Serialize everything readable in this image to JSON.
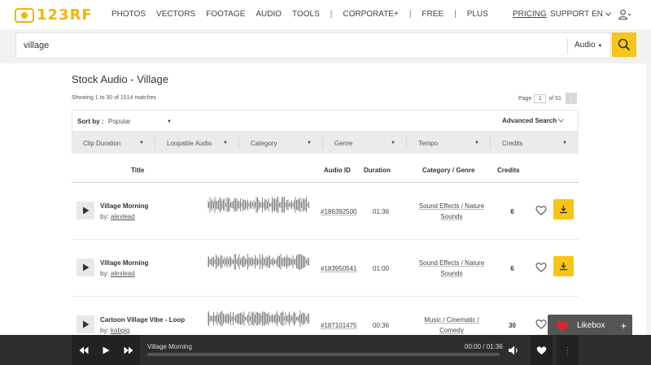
{
  "brand": {
    "logo_text": "123RF"
  },
  "nav": {
    "items": [
      "PHOTOS",
      "VECTORS",
      "FOOTAGE",
      "AUDIO",
      "TOOLS",
      "|",
      "CORPORATE+",
      "|",
      "FREE",
      "|",
      "PLUS"
    ],
    "pricing": "PRICING",
    "support": "SUPPORT",
    "lang": "EN"
  },
  "search": {
    "query": "village",
    "type": "Audio"
  },
  "page": {
    "title": "Stock Audio - Village",
    "showing": "Showing 1 to 30 of 1514 matches",
    "page_label": "Page",
    "page_num": "1",
    "page_total": "of 51"
  },
  "sort": {
    "label": "Sort by :",
    "value": "Popular",
    "advanced": "Advanced Search"
  },
  "filters": [
    "Clip Duration",
    "Loopable Audio",
    "Category",
    "Genre",
    "Tempo",
    "Credits"
  ],
  "table": {
    "headers": {
      "title": "Title",
      "audio_id": "Audio ID",
      "duration": "Duration",
      "category": "Category / Genre",
      "credits": "Credits"
    },
    "rows": [
      {
        "title": "Village Morning",
        "by_label": "by:",
        "author": "alexlead",
        "audio_id": "#186392500",
        "duration": "01:36",
        "category_line1": "Sound Effects / Nature",
        "category_line2": "Sounds",
        "credits": "6"
      },
      {
        "title": "Village Morning",
        "by_label": "by:",
        "author": "alexlead",
        "audio_id": "#183950541",
        "duration": "01:00",
        "category_line1": "Sound Effects / Nature",
        "category_line2": "Sounds",
        "credits": "6"
      },
      {
        "title": "Cartoon Village Vibe - Loop",
        "by_label": "by:",
        "author": "kabgig",
        "audio_id": "#187101475",
        "duration": "00:36",
        "category_line1": "Music / Cinematic /",
        "category_line2": "Comedy",
        "credits": "30"
      }
    ]
  },
  "likebox": {
    "label": "Likebox",
    "plus": "+"
  },
  "player": {
    "title": "Village Morning",
    "time": "00:00 / 01:36"
  },
  "colors": {
    "accent": "#f5c518",
    "player_bg": "#2d2d2d",
    "like_red": "#e0242c"
  }
}
